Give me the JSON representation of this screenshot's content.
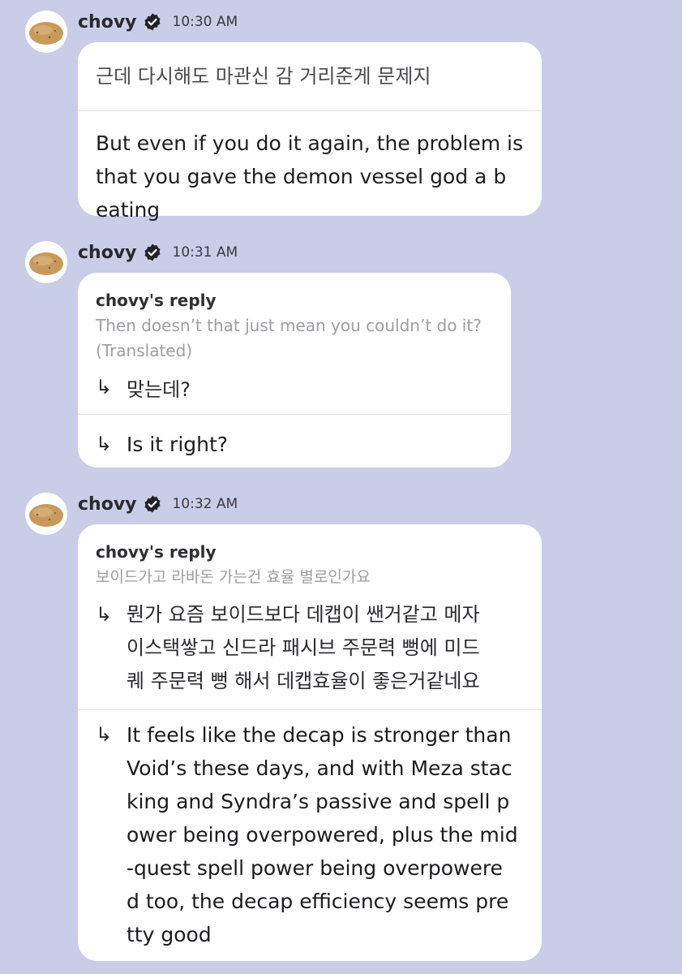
{
  "messages": [
    {
      "name": "chovy",
      "time": "10:30 AM",
      "original": "근데 다시해도 마관신 감 거리준게 문제지",
      "translation": "But even if you do it again, the problem is\n that you gave the demon vessel god a b\neating"
    },
    {
      "name": "chovy",
      "time": "10:31 AM",
      "reply_label": "chovy's reply",
      "quoted": "Then doesn’t that just mean you couldn’t do it?\n(Translated)",
      "arrow": "↳",
      "original": "맞는데?",
      "translation": "Is it right?"
    },
    {
      "name": "chovy",
      "time": "10:32 AM",
      "reply_label": "chovy's reply",
      "quoted": "보이드가고 라바돈 가는건 효율 별로인가요",
      "arrow": "↳",
      "original": "뭔가 요즘 보이드보다 데캡이 쌘거같고 메자\n이스택쌓고 신드라 패시브 주문력 뻥에 미드\n퀘 주문력 뻥 해서 데캡효율이 좋은거같네요",
      "translation": "It feels like the decap is stronger than\nVoid’s these days, and with Meza stac\nking and Syndra’s passive and spell p\nower being overpowered, plus the mid\n-quest spell power being overpowere\nd too, the decap efficiency seems pre\ntty good"
    }
  ],
  "icons": {
    "avatar": "potato-avatar-icon",
    "verified": "verified-badge-icon"
  },
  "colors": {
    "background": "#c9cde8",
    "bubble": "#ffffff",
    "quoted_text": "#9d9da4"
  }
}
